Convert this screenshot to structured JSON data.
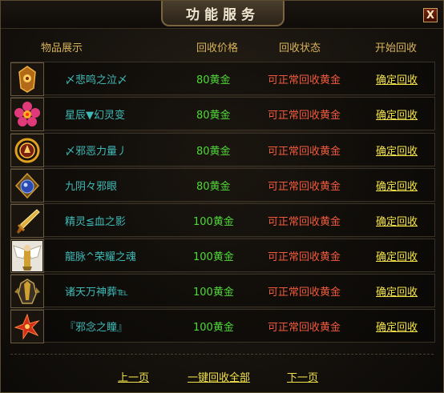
{
  "window": {
    "title": "功能服务",
    "close_label": "X"
  },
  "columns": [
    "物品展示",
    "回收价格",
    "回收状态",
    "开始回收"
  ],
  "items": [
    {
      "name": "〆悲鸣之泣〆",
      "price": "80黄金",
      "status": "可正常回收黄金",
      "action": "确定回收",
      "icon": "amber-totem-icon"
    },
    {
      "name": "星辰▼幻灵变",
      "price": "80黄金",
      "status": "可正常回收黄金",
      "action": "确定回收",
      "icon": "pink-flower-gem-icon"
    },
    {
      "name": "〆邪恶力量丿",
      "price": "80黄金",
      "status": "可正常回收黄金",
      "action": "确定回收",
      "icon": "gold-emblem-icon"
    },
    {
      "name": "九阴々邪眼",
      "price": "80黄金",
      "status": "可正常回收黄金",
      "action": "确定回收",
      "icon": "blue-orb-icon"
    },
    {
      "name": "精灵≦血之影",
      "price": "100黄金",
      "status": "可正常回收黄金",
      "action": "确定回收",
      "icon": "golden-blade-icon"
    },
    {
      "name": "龍脉^荣耀之魂",
      "price": "100黄金",
      "status": "可正常回收黄金",
      "action": "确定回收",
      "icon": "winged-warrior-icon"
    },
    {
      "name": "诸天万神葬℡",
      "price": "100黄金",
      "status": "可正常回收黄金",
      "action": "确定回收",
      "icon": "dark-armor-icon"
    },
    {
      "name": "『邪念之瞳』",
      "price": "100黄金",
      "status": "可正常回收黄金",
      "action": "确定回收",
      "icon": "red-star-gem-icon"
    }
  ],
  "footer": {
    "prev": "上一页",
    "recycle_all": "一键回收全部",
    "next": "下一页"
  },
  "colors": {
    "header": "#d7b35a",
    "name": "#3fbab8",
    "price": "#50d838",
    "status": "#f05a3c",
    "link": "#f2e24a"
  }
}
